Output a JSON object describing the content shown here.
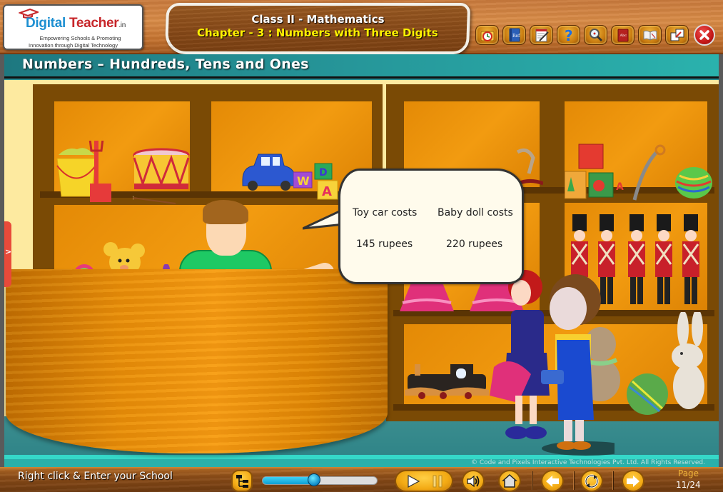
{
  "header": {
    "logo": {
      "brand_part1": "Digital",
      "brand_part2": "Teacher",
      "brand_suffix": ".in",
      "tagline_line1": "Empowering Schools & Promoting",
      "tagline_line2": "Innovation through Digital Technology"
    },
    "class_title": "Class II - Mathematics",
    "chapter_title": "Chapter - 3 : Numbers with Three Digits",
    "toolbar": [
      {
        "icon": "history-clock-icon",
        "label": "History"
      },
      {
        "icon": "reference-book-icon",
        "label": "Ref"
      },
      {
        "icon": "notepad-icon",
        "label": "Notes"
      },
      {
        "icon": "help-icon",
        "label": "?"
      },
      {
        "icon": "magnifier-icon",
        "label": "Search"
      },
      {
        "icon": "dictionary-icon",
        "label": "Abc"
      },
      {
        "icon": "open-book-icon",
        "label": "Book"
      },
      {
        "icon": "restore-window-icon",
        "label": "Resize"
      },
      {
        "icon": "close-icon",
        "label": "Close"
      }
    ]
  },
  "section_title": "Numbers – Hundreds, Tens and Ones",
  "scene": {
    "side_tab_glyph": ">",
    "speech_bubble": {
      "item1_label": "Toy car costs",
      "item1_price": "145 rupees",
      "item2_label": "Baby doll costs",
      "item2_price": "220 rupees"
    },
    "copyright": "© Code and Pixels Interactive Technologies  Pvt. Ltd. All Rights Reserved."
  },
  "footer": {
    "school_prompt": "Right click & Enter your School",
    "progress_fraction": 0.45,
    "page_label": "Page",
    "page_current": "11/24",
    "colors": {
      "button_gold": "#f3aa14",
      "slider_fill": "#0ea0d4",
      "page_label": "#f0b43a"
    }
  },
  "colors": {
    "title_yellow": "#fff200",
    "section_teal": "#26979a",
    "shelf_orange": "#f29b10",
    "shirt_green": "#1ec964"
  }
}
